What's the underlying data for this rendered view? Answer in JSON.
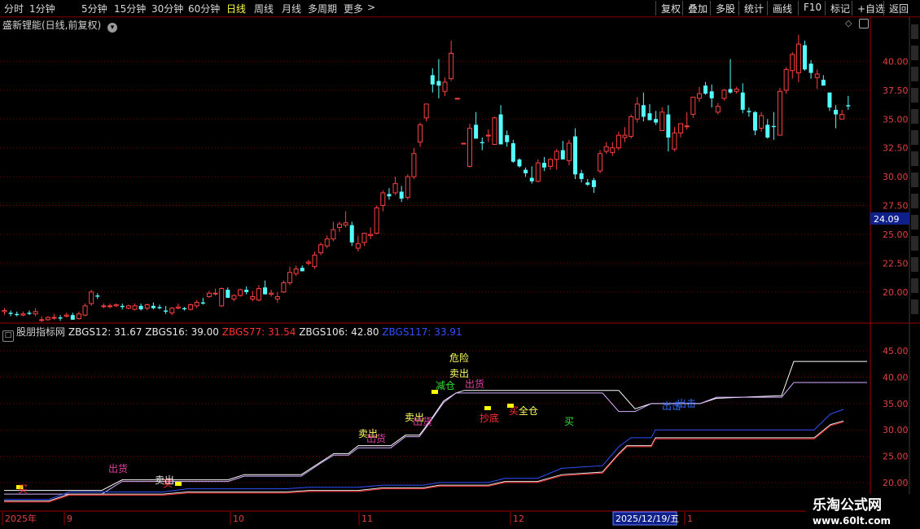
{
  "periods": [
    {
      "label": "分时",
      "active": false
    },
    {
      "label": "1分钟",
      "active": false
    },
    {
      "label": "5分钟",
      "active": false
    },
    {
      "label": "15分钟",
      "active": false
    },
    {
      "label": "30分钟",
      "active": false
    },
    {
      "label": "60分钟",
      "active": false
    },
    {
      "label": "日线",
      "active": true
    },
    {
      "label": "周线",
      "active": false
    },
    {
      "label": "月线",
      "active": false
    },
    {
      "label": "多周期",
      "active": false
    },
    {
      "label": "更多",
      "active": false
    }
  ],
  "tools": [
    "复权",
    "叠加",
    "多股",
    "统计",
    "画线",
    "F10",
    "标记",
    "+自选",
    "返回"
  ],
  "main_panel": {
    "title": "盛新锂能(日线,前复权)",
    "price_marker": "24.09"
  },
  "indicator_panel": {
    "title": "股朋指标网",
    "values": [
      {
        "name": "ZBGS12",
        "value": "31.67",
        "color": "#e8e8e8"
      },
      {
        "name": "ZBGS16",
        "value": "39.00",
        "color": "#e8e8e8"
      },
      {
        "name": "ZBGS77",
        "value": "31.54",
        "color": "#ff3030"
      },
      {
        "name": "ZBGS106",
        "value": "42.80",
        "color": "#e8e8e8"
      },
      {
        "name": "ZBGS117",
        "value": "33.91",
        "color": "#3050ff"
      }
    ]
  },
  "date_axis": {
    "labels": [
      "2025年",
      "9",
      "10",
      "11",
      "12",
      "1"
    ],
    "highlight": "2025/12/19/五"
  },
  "watermark": {
    "line1": "乐淘公式网",
    "line2": "www.60lt.com"
  },
  "chart_data": [
    {
      "type": "candlestick",
      "title": "盛新锂能(日线,前复权)",
      "ylim": [
        17.8,
        42.5
      ],
      "yticks": [
        40.0,
        37.5,
        35.0,
        32.5,
        30.0,
        27.5,
        25.0,
        22.5,
        20.0
      ],
      "colors": {
        "up": "#ff4040",
        "down": "#54ffff",
        "grid": "#800000"
      },
      "note": "candles [open, high, low, close] in CNY"
    },
    {
      "type": "line",
      "title": "股朋指标网",
      "ylim": [
        15.5,
        47.5
      ],
      "yticks": [
        45.0,
        40.0,
        35.0,
        30.0,
        25.0,
        20.0
      ],
      "annotations": [
        {
          "label": "危险",
          "color": "#ffff60"
        },
        {
          "label": "卖出",
          "color": "#ffff60"
        },
        {
          "label": "减仓",
          "color": "#30e030"
        },
        {
          "label": "出货",
          "color": "#e040a0"
        },
        {
          "label": "抄底",
          "color": "#ff3030"
        },
        {
          "label": "买",
          "color": "#ff3030"
        },
        {
          "label": "全仓",
          "color": "#ffff60"
        },
        {
          "label": "买",
          "color": "#30e030"
        },
        {
          "label": "出击",
          "color": "#3070ff"
        }
      ]
    }
  ]
}
